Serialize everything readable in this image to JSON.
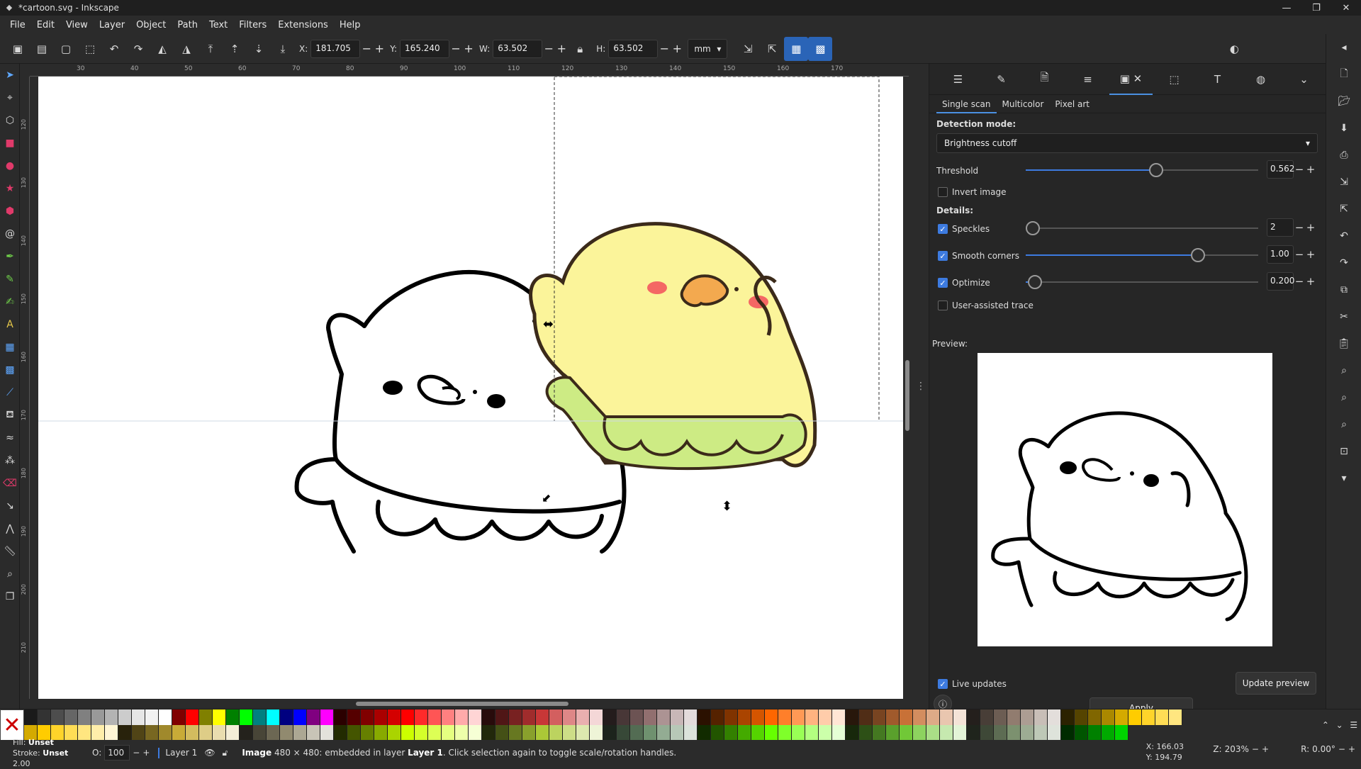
{
  "window": {
    "title": "*cartoon.svg - Inkscape",
    "min": "—",
    "max": "❐",
    "close": "✕"
  },
  "menu": [
    "File",
    "Edit",
    "View",
    "Layer",
    "Object",
    "Path",
    "Text",
    "Filters",
    "Extensions",
    "Help"
  ],
  "toolbar": {
    "x_label": "X:",
    "x_value": "181.705",
    "y_label": "Y:",
    "y_value": "165.240",
    "w_label": "W:",
    "w_value": "63.502",
    "h_label": "H:",
    "h_value": "63.502",
    "unit": "mm"
  },
  "ruler_top": [
    "30",
    "40",
    "50",
    "60",
    "70",
    "80",
    "90",
    "100",
    "110",
    "120",
    "130",
    "140",
    "150",
    "160",
    "170"
  ],
  "ruler_left": [
    "120",
    "130",
    "140",
    "150",
    "160",
    "170",
    "180",
    "190",
    "200",
    "210"
  ],
  "trace": {
    "tabs": [
      "Single scan",
      "Multicolor",
      "Pixel art"
    ],
    "detection_label": "Detection mode:",
    "detection_value": "Brightness cutoff",
    "threshold_label": "Threshold",
    "threshold_value": "0.562",
    "threshold_level": 0.56,
    "invert_label": "Invert image",
    "details_label": "Details:",
    "speckles_label": "Speckles",
    "speckles_value": "2",
    "smooth_label": "Smooth corners",
    "smooth_value": "1.00",
    "smooth_level": 0.74,
    "optimize_label": "Optimize",
    "optimize_value": "0.200",
    "optimize_level": 0.04,
    "user_assisted_label": "User-assisted trace",
    "preview_label": "Preview:",
    "live_label": "Live updates",
    "update_label": "Update preview",
    "apply_label": "Apply"
  },
  "status": {
    "fill_label": "Fill:",
    "fill_value": "Unset",
    "stroke_label": "Stroke:",
    "stroke_value": "Unset",
    "stroke_width": "2.00",
    "opacity_label": "O:",
    "opacity_value": "100",
    "layer": "Layer 1",
    "msg_bold": "Image",
    "msg_mid": " 480 × 480: embedded in layer ",
    "msg_layer": "Layer 1",
    "msg_end": ". Click selection again to toggle scale/rotation handles.",
    "cx": "X:   166.03",
    "cy": "Y:   194.79",
    "zoom_label": "Z:",
    "zoom_value": "203%",
    "rot_label": "R:",
    "rot_value": "0.00°"
  },
  "colors": {
    "accent": "#3d7be0",
    "chick_body": "#fbf49a",
    "chick_skirt": "#cdeb84",
    "beak": "#f3a94f",
    "cheek": "#f24d5a"
  }
}
